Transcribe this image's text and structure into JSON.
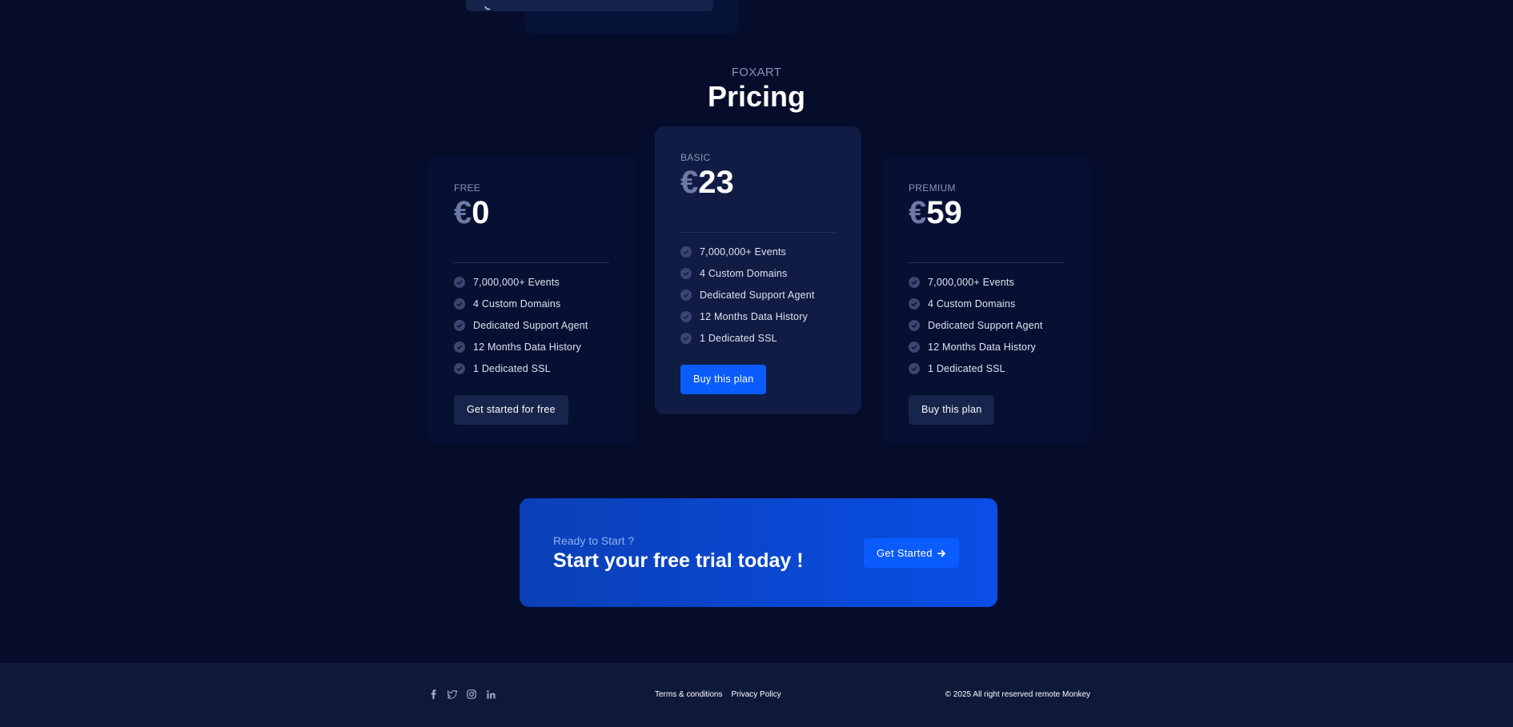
{
  "section": {
    "eyebrow": "FOXART",
    "title": "Pricing"
  },
  "plans": [
    {
      "name": "FREE",
      "currency": "€",
      "amount": "0",
      "features": [
        "7,000,000+ Events",
        "4 Custom Domains",
        "Dedicated Support Agent",
        "12 Months Data History",
        "1 Dedicated SSL"
      ],
      "button": "Get started for free"
    },
    {
      "name": "BASIC",
      "currency": "€",
      "amount": "23",
      "features": [
        "7,000,000+ Events",
        "4 Custom Domains",
        "Dedicated Support Agent",
        "12 Months Data History",
        "1 Dedicated SSL"
      ],
      "button": "Buy this plan"
    },
    {
      "name": "PREMIUM",
      "currency": "€",
      "amount": "59",
      "features": [
        "7,000,000+ Events",
        "4 Custom Domains",
        "Dedicated Support Agent",
        "12 Months Data History",
        "1 Dedicated SSL"
      ],
      "button": "Buy this plan"
    }
  ],
  "cta": {
    "subtitle": "Ready to Start ?",
    "title": "Start your free trial today !",
    "button": "Get Started"
  },
  "footer": {
    "social_icons": [
      "facebook-icon",
      "twitter-icon",
      "instagram-icon",
      "linkedin-icon"
    ],
    "links": [
      "Terms & conditions",
      "Privacy Policy"
    ],
    "copyright": "© 2025 All right reserved remote Monkey"
  },
  "colors": {
    "background": "#050d2a",
    "card": "#061033",
    "card_highlight": "#101c44",
    "accent": "#0a5cff",
    "footer": "#0e1839"
  }
}
